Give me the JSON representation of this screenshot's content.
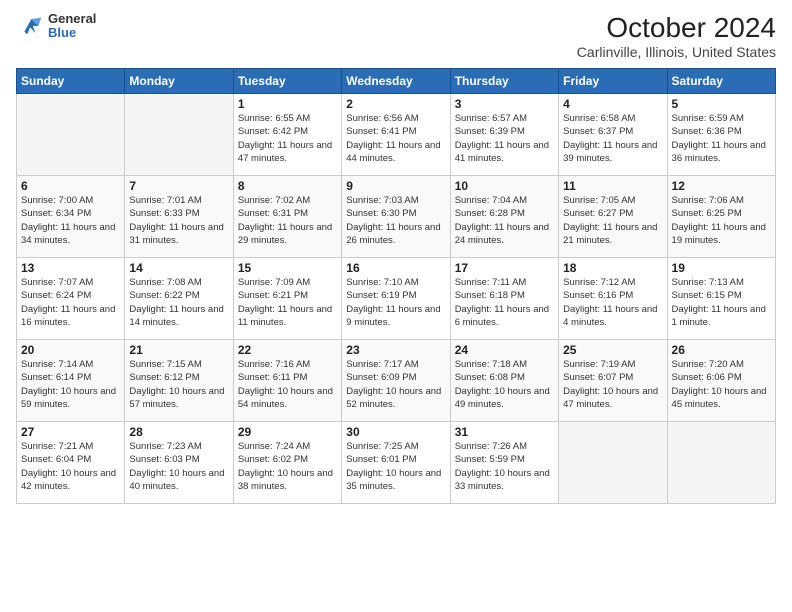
{
  "logo": {
    "general": "General",
    "blue": "Blue"
  },
  "title": "October 2024",
  "subtitle": "Carlinville, Illinois, United States",
  "days_of_week": [
    "Sunday",
    "Monday",
    "Tuesday",
    "Wednesday",
    "Thursday",
    "Friday",
    "Saturday"
  ],
  "weeks": [
    [
      {
        "day": "",
        "info": ""
      },
      {
        "day": "",
        "info": ""
      },
      {
        "day": "1",
        "info": "Sunrise: 6:55 AM\nSunset: 6:42 PM\nDaylight: 11 hours and 47 minutes."
      },
      {
        "day": "2",
        "info": "Sunrise: 6:56 AM\nSunset: 6:41 PM\nDaylight: 11 hours and 44 minutes."
      },
      {
        "day": "3",
        "info": "Sunrise: 6:57 AM\nSunset: 6:39 PM\nDaylight: 11 hours and 41 minutes."
      },
      {
        "day": "4",
        "info": "Sunrise: 6:58 AM\nSunset: 6:37 PM\nDaylight: 11 hours and 39 minutes."
      },
      {
        "day": "5",
        "info": "Sunrise: 6:59 AM\nSunset: 6:36 PM\nDaylight: 11 hours and 36 minutes."
      }
    ],
    [
      {
        "day": "6",
        "info": "Sunrise: 7:00 AM\nSunset: 6:34 PM\nDaylight: 11 hours and 34 minutes."
      },
      {
        "day": "7",
        "info": "Sunrise: 7:01 AM\nSunset: 6:33 PM\nDaylight: 11 hours and 31 minutes."
      },
      {
        "day": "8",
        "info": "Sunrise: 7:02 AM\nSunset: 6:31 PM\nDaylight: 11 hours and 29 minutes."
      },
      {
        "day": "9",
        "info": "Sunrise: 7:03 AM\nSunset: 6:30 PM\nDaylight: 11 hours and 26 minutes."
      },
      {
        "day": "10",
        "info": "Sunrise: 7:04 AM\nSunset: 6:28 PM\nDaylight: 11 hours and 24 minutes."
      },
      {
        "day": "11",
        "info": "Sunrise: 7:05 AM\nSunset: 6:27 PM\nDaylight: 11 hours and 21 minutes."
      },
      {
        "day": "12",
        "info": "Sunrise: 7:06 AM\nSunset: 6:25 PM\nDaylight: 11 hours and 19 minutes."
      }
    ],
    [
      {
        "day": "13",
        "info": "Sunrise: 7:07 AM\nSunset: 6:24 PM\nDaylight: 11 hours and 16 minutes."
      },
      {
        "day": "14",
        "info": "Sunrise: 7:08 AM\nSunset: 6:22 PM\nDaylight: 11 hours and 14 minutes."
      },
      {
        "day": "15",
        "info": "Sunrise: 7:09 AM\nSunset: 6:21 PM\nDaylight: 11 hours and 11 minutes."
      },
      {
        "day": "16",
        "info": "Sunrise: 7:10 AM\nSunset: 6:19 PM\nDaylight: 11 hours and 9 minutes."
      },
      {
        "day": "17",
        "info": "Sunrise: 7:11 AM\nSunset: 6:18 PM\nDaylight: 11 hours and 6 minutes."
      },
      {
        "day": "18",
        "info": "Sunrise: 7:12 AM\nSunset: 6:16 PM\nDaylight: 11 hours and 4 minutes."
      },
      {
        "day": "19",
        "info": "Sunrise: 7:13 AM\nSunset: 6:15 PM\nDaylight: 11 hours and 1 minute."
      }
    ],
    [
      {
        "day": "20",
        "info": "Sunrise: 7:14 AM\nSunset: 6:14 PM\nDaylight: 10 hours and 59 minutes."
      },
      {
        "day": "21",
        "info": "Sunrise: 7:15 AM\nSunset: 6:12 PM\nDaylight: 10 hours and 57 minutes."
      },
      {
        "day": "22",
        "info": "Sunrise: 7:16 AM\nSunset: 6:11 PM\nDaylight: 10 hours and 54 minutes."
      },
      {
        "day": "23",
        "info": "Sunrise: 7:17 AM\nSunset: 6:09 PM\nDaylight: 10 hours and 52 minutes."
      },
      {
        "day": "24",
        "info": "Sunrise: 7:18 AM\nSunset: 6:08 PM\nDaylight: 10 hours and 49 minutes."
      },
      {
        "day": "25",
        "info": "Sunrise: 7:19 AM\nSunset: 6:07 PM\nDaylight: 10 hours and 47 minutes."
      },
      {
        "day": "26",
        "info": "Sunrise: 7:20 AM\nSunset: 6:06 PM\nDaylight: 10 hours and 45 minutes."
      }
    ],
    [
      {
        "day": "27",
        "info": "Sunrise: 7:21 AM\nSunset: 6:04 PM\nDaylight: 10 hours and 42 minutes."
      },
      {
        "day": "28",
        "info": "Sunrise: 7:23 AM\nSunset: 6:03 PM\nDaylight: 10 hours and 40 minutes."
      },
      {
        "day": "29",
        "info": "Sunrise: 7:24 AM\nSunset: 6:02 PM\nDaylight: 10 hours and 38 minutes."
      },
      {
        "day": "30",
        "info": "Sunrise: 7:25 AM\nSunset: 6:01 PM\nDaylight: 10 hours and 35 minutes."
      },
      {
        "day": "31",
        "info": "Sunrise: 7:26 AM\nSunset: 5:59 PM\nDaylight: 10 hours and 33 minutes."
      },
      {
        "day": "",
        "info": ""
      },
      {
        "day": "",
        "info": ""
      }
    ]
  ]
}
